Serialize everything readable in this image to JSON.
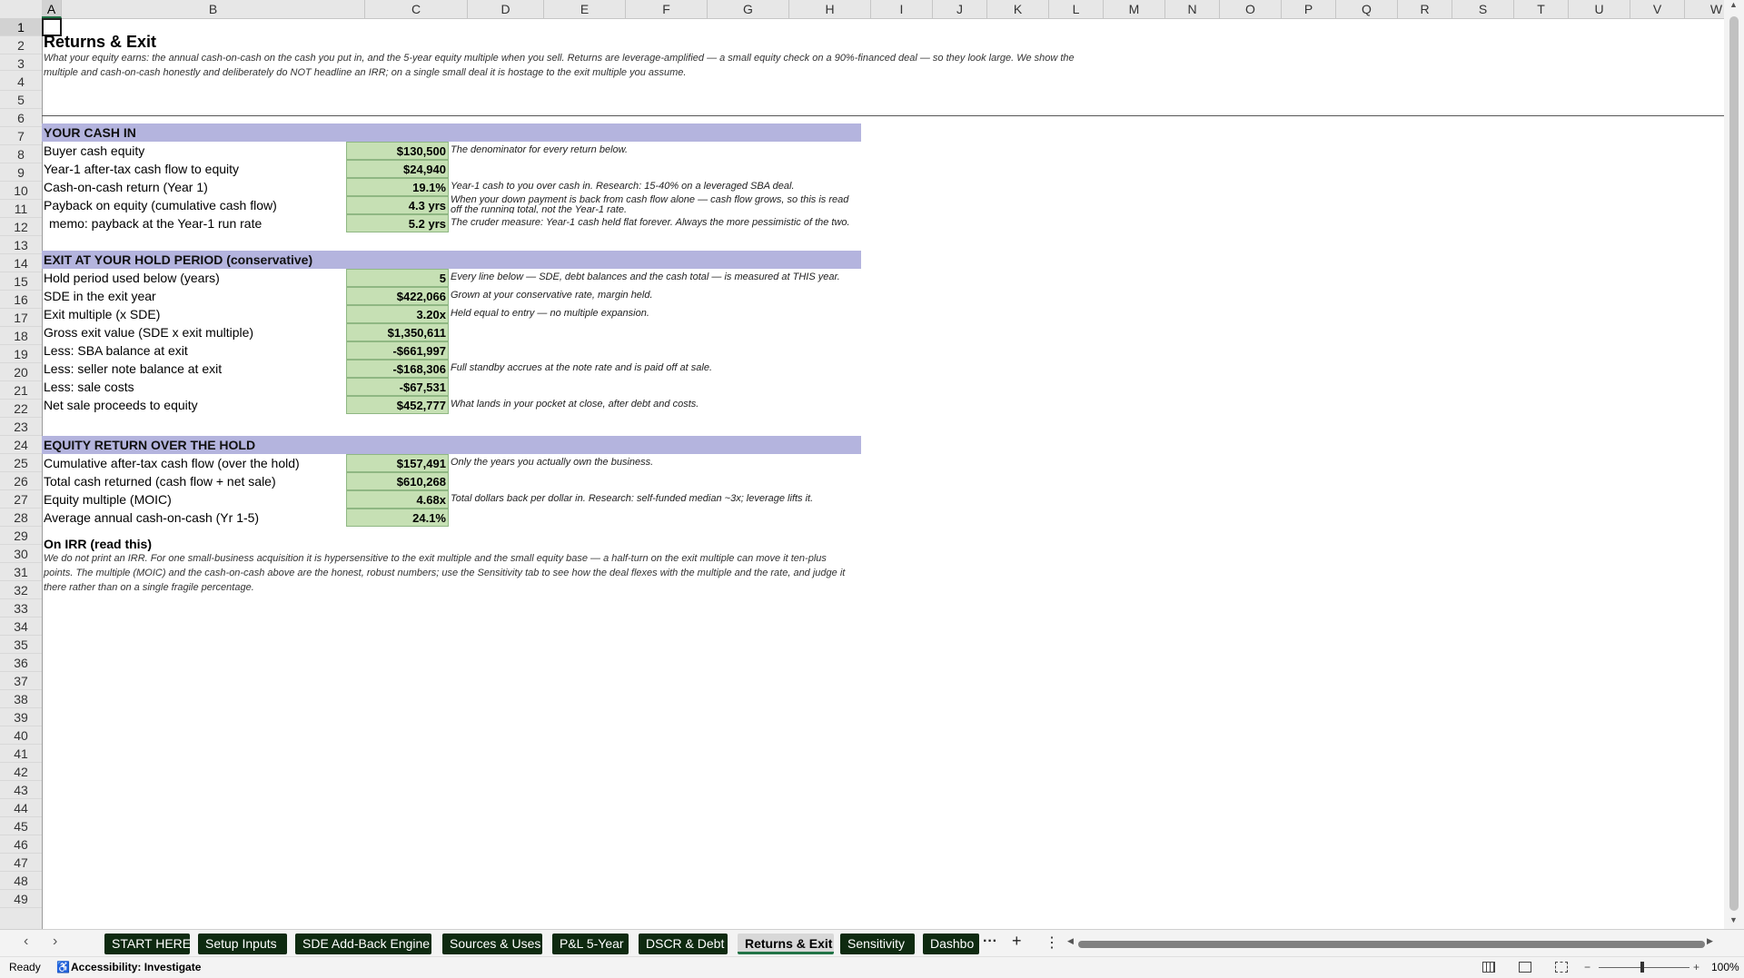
{
  "columns": [
    "A",
    "B",
    "C",
    "D",
    "E",
    "F",
    "G",
    "H",
    "I",
    "J",
    "K",
    "L",
    "M",
    "N",
    "O",
    "P",
    "Q",
    "R",
    "S",
    "T",
    "U",
    "V",
    "W"
  ],
  "rows": [
    "1",
    "2",
    "3",
    "4",
    "5",
    "6",
    "7",
    "8",
    "9",
    "10",
    "11",
    "12",
    "13",
    "14",
    "15",
    "16",
    "17",
    "18",
    "19",
    "20",
    "21",
    "22",
    "23",
    "24",
    "25",
    "26",
    "27",
    "28",
    "29",
    "30",
    "31",
    "32",
    "33",
    "34",
    "35",
    "36",
    "37",
    "38",
    "39",
    "40",
    "41",
    "42",
    "43",
    "44",
    "45",
    "46",
    "47",
    "48",
    "49"
  ],
  "sheet": {
    "title": "Returns & Exit",
    "intro_line1": "What your equity earns: the annual cash-on-cash on the cash you put in, and the 5-year equity multiple when you sell. Returns are leverage-amplified — a small equity check on a 90%-financed deal — so they look large. We show the",
    "intro_line2": "multiple and cash-on-cash honestly and deliberately do NOT headline an IRR; on a single small deal it is hostage to the exit multiple you assume.",
    "sections": [
      {
        "header": "YOUR CASH IN",
        "rows": [
          {
            "label": "Buyer cash equity",
            "value": "$130,500",
            "note": "The denominator for every return below."
          },
          {
            "label": "Year-1 after-tax cash flow to equity",
            "value": "$24,940",
            "note": ""
          },
          {
            "label": "Cash-on-cash return (Year 1)",
            "value": "19.1%",
            "note": "Year-1 cash to you over cash in. Research: 15-40% on a leveraged SBA deal."
          },
          {
            "label": "Payback on equity (cumulative cash flow)",
            "value": "4.3 yrs",
            "note": "When your down payment is back from cash flow alone — cash flow grows, so this is read off the running total, not the Year-1 rate."
          },
          {
            "label": "  memo: payback at the Year-1 run rate",
            "value": "5.2 yrs",
            "note": "The cruder measure: Year-1 cash held flat forever. Always the more pessimistic of the two."
          }
        ]
      },
      {
        "header": "EXIT AT YOUR HOLD PERIOD (conservative)",
        "rows": [
          {
            "label": "Hold period used below (years)",
            "value": "5",
            "note": "Every line below — SDE, debt balances and the cash total — is measured at THIS year."
          },
          {
            "label": "SDE in the exit year",
            "value": "$422,066",
            "note": "Grown at your conservative rate, margin held."
          },
          {
            "label": "Exit multiple (x SDE)",
            "value": "3.20x",
            "note": "Held equal to entry — no multiple expansion."
          },
          {
            "label": "Gross exit value (SDE x exit multiple)",
            "value": "$1,350,611",
            "note": ""
          },
          {
            "label": "Less: SBA balance at exit",
            "value": "-$661,997",
            "note": ""
          },
          {
            "label": "Less: seller note balance at exit",
            "value": "-$168,306",
            "note": "Full standby accrues at the note rate and is paid off at sale."
          },
          {
            "label": "Less: sale costs",
            "value": "-$67,531",
            "note": ""
          },
          {
            "label": "Net sale proceeds to equity",
            "value": "$452,777",
            "note": "What lands in your pocket at close, after debt and costs."
          }
        ]
      },
      {
        "header": "EQUITY RETURN OVER THE HOLD",
        "rows": [
          {
            "label": "Cumulative after-tax cash flow (over the hold)",
            "value": "$157,491",
            "note": "Only the years you actually own the business."
          },
          {
            "label": "Total cash returned (cash flow + net sale)",
            "value": "$610,268",
            "note": ""
          },
          {
            "label": "Equity multiple (MOIC)",
            "value": "4.68x",
            "note": "Total dollars back per dollar in. Research: self-funded median ~3x; leverage lifts it."
          },
          {
            "label": "Average annual cash-on-cash (Yr 1-5)",
            "value": "24.1%",
            "note": ""
          }
        ]
      }
    ],
    "irr_heading": "On IRR (read this)",
    "irr_line1": "We do not print an IRR. For one small-business acquisition it is hypersensitive to the exit multiple and the small equity base — a half-turn on the exit multiple can move it ten-plus",
    "irr_line2": "points. The multiple (MOIC) and the cash-on-cash above are the honest, robust numbers; use the Sensitivity tab to see how the deal flexes with the multiple and the rate, and judge it",
    "irr_line3": "there rather than on a single fragile percentage."
  },
  "tabs": [
    "START HERE",
    "Setup Inputs",
    "SDE Add-Back Engine",
    "Sources & Uses",
    "P&L 5-Year",
    "DSCR & Debt",
    "Returns & Exit",
    "Sensitivity",
    "Dashbo"
  ],
  "active_tab": "Returns & Exit",
  "tab_more": "···",
  "tab_add": "+",
  "tab_menu": "⋮",
  "status": {
    "ready": "Ready",
    "accessibility": "Accessibility: Investigate",
    "zoom": "100%"
  },
  "colors": {
    "section_header": "#b4b4de",
    "value_fill": "#c6e0b4",
    "tab_dark": "#0e2a10",
    "accent": "#217346"
  }
}
